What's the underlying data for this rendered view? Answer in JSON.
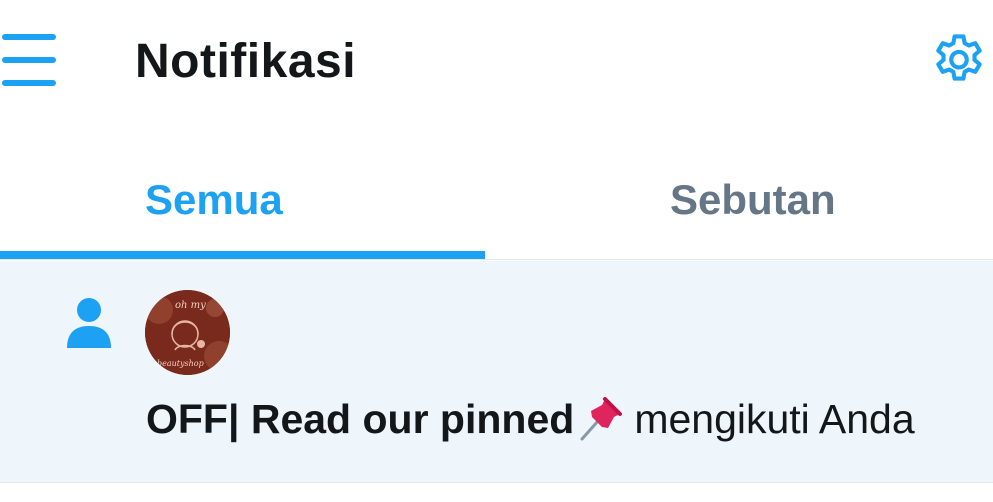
{
  "header": {
    "title": "Notifikasi",
    "menu_icon": "hamburger-menu-icon",
    "settings_icon": "gear-icon"
  },
  "tabs": [
    {
      "label": "Semua",
      "active": true
    },
    {
      "label": "Sebutan",
      "active": false
    }
  ],
  "notifications": [
    {
      "type": "follow",
      "type_icon": "person-icon",
      "avatar_text": [
        "oh my",
        "beautyshop"
      ],
      "user_name": "OFF| Read our pinned",
      "name_emoji": "pushpin-icon",
      "action": "mengikuti Anda"
    }
  ],
  "colors": {
    "accent": "#1da1f2",
    "inactive_tab": "#657786",
    "text": "#14171a",
    "unread_background": "#eef5fb",
    "avatar_background": "#7a2a1c"
  }
}
